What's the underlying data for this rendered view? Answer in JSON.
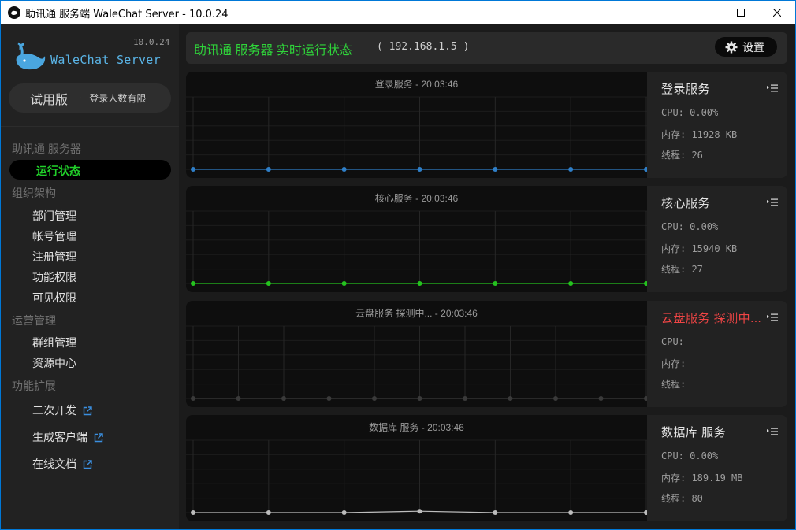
{
  "window": {
    "title": "助讯通 服务端 WaleChat Server - 10.0.24"
  },
  "sidebar": {
    "brand": "WaleChat Server",
    "version": "10.0.24",
    "trial": {
      "label": "试用版",
      "dot": "·",
      "note": "登录人数有限"
    },
    "groups": [
      {
        "label": "助讯通 服务器",
        "items": [
          {
            "label": "运行状态",
            "active": true
          }
        ]
      },
      {
        "label": "组织架构",
        "items": [
          {
            "label": "部门管理"
          },
          {
            "label": "帐号管理"
          },
          {
            "label": "注册管理"
          },
          {
            "label": "功能权限"
          },
          {
            "label": "可见权限"
          }
        ]
      },
      {
        "label": "运营管理",
        "items": [
          {
            "label": "群组管理"
          },
          {
            "label": "资源中心"
          }
        ]
      },
      {
        "label": "功能扩展",
        "items": [
          {
            "label": "二次开发",
            "external": true
          },
          {
            "label": "生成客户端",
            "external": true
          },
          {
            "label": "在线文档",
            "external": true
          }
        ]
      }
    ]
  },
  "header": {
    "title": "助讯通 服务器 实时运行状态",
    "ip": "( 192.168.1.5 )",
    "settings_label": "设置"
  },
  "colors": {
    "accent_green": "#2fd43a",
    "login_series": "#2f7fc8",
    "core_series": "#25c21f",
    "cloud_series": "#3a3a3a",
    "db_series": "#bdbdbd",
    "warning": "#f04545",
    "brand_blue": "#5ab4e6"
  },
  "panels": [
    {
      "chart_title": "登录服务 - 20:03:46",
      "name": "登录服务",
      "status": "ok",
      "cpu": "CPU: 0.00%",
      "mem": "内存: 11928 KB",
      "threads": "线程: 26",
      "series_color": "#2f7fc8",
      "values": [
        0,
        0,
        0,
        0,
        0,
        0,
        0
      ]
    },
    {
      "chart_title": "核心服务 - 20:03:46",
      "name": "核心服务",
      "status": "ok",
      "cpu": "CPU: 0.00%",
      "mem": "内存: 15940 KB",
      "threads": "线程: 27",
      "series_color": "#25c21f",
      "values": [
        0,
        0,
        0,
        0,
        0,
        0,
        0
      ]
    },
    {
      "chart_title": "云盘服务 探测中... - 20:03:46",
      "name": "云盘服务 探测中...",
      "status": "warn",
      "cpu": "CPU:",
      "mem": "内存:",
      "threads": "线程:",
      "series_color": "#3a3a3a",
      "values": [
        0,
        0,
        0,
        0,
        0,
        0,
        0,
        0,
        0,
        0,
        0
      ]
    },
    {
      "chart_title": "数据库 服务 - 20:03:46",
      "name": "数据库 服务",
      "status": "ok",
      "cpu": "CPU: 0.00%",
      "mem": "内存: 189.19 MB",
      "threads": "线程: 80",
      "series_color": "#bdbdbd",
      "values": [
        0,
        0,
        0,
        0.6,
        0,
        0,
        0
      ]
    }
  ]
}
